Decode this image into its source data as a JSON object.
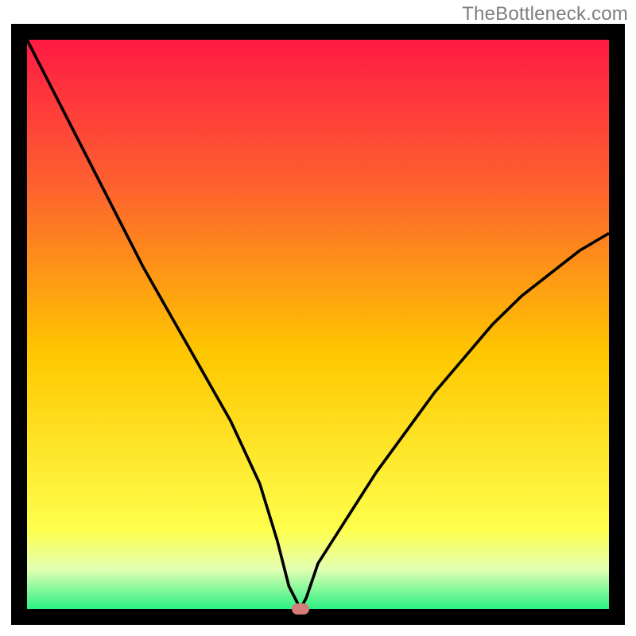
{
  "watermark": "TheBottleneck.com",
  "chart_data": {
    "type": "line",
    "title": "",
    "xlabel": "",
    "ylabel": "",
    "xlim": [
      0,
      100
    ],
    "ylim": [
      0,
      100
    ],
    "x": [
      0,
      5,
      10,
      15,
      20,
      25,
      30,
      35,
      40,
      43,
      45,
      47,
      48,
      50,
      55,
      60,
      65,
      70,
      75,
      80,
      85,
      90,
      95,
      100
    ],
    "values": [
      100,
      90,
      80,
      70,
      60,
      51,
      42,
      33,
      22,
      12,
      4,
      0,
      2,
      8,
      16,
      24,
      31,
      38,
      44,
      50,
      55,
      59,
      63,
      66
    ],
    "optimum_x": 47,
    "optimum_y": 0,
    "marker_color": "#d47c77",
    "gradient": {
      "top": "#fe1b44",
      "upper": "#fd5f2f",
      "mid": "#fec700",
      "lowermid": "#feff4c",
      "lower": "#e4ffb2",
      "bottom": "#2bf185"
    }
  }
}
